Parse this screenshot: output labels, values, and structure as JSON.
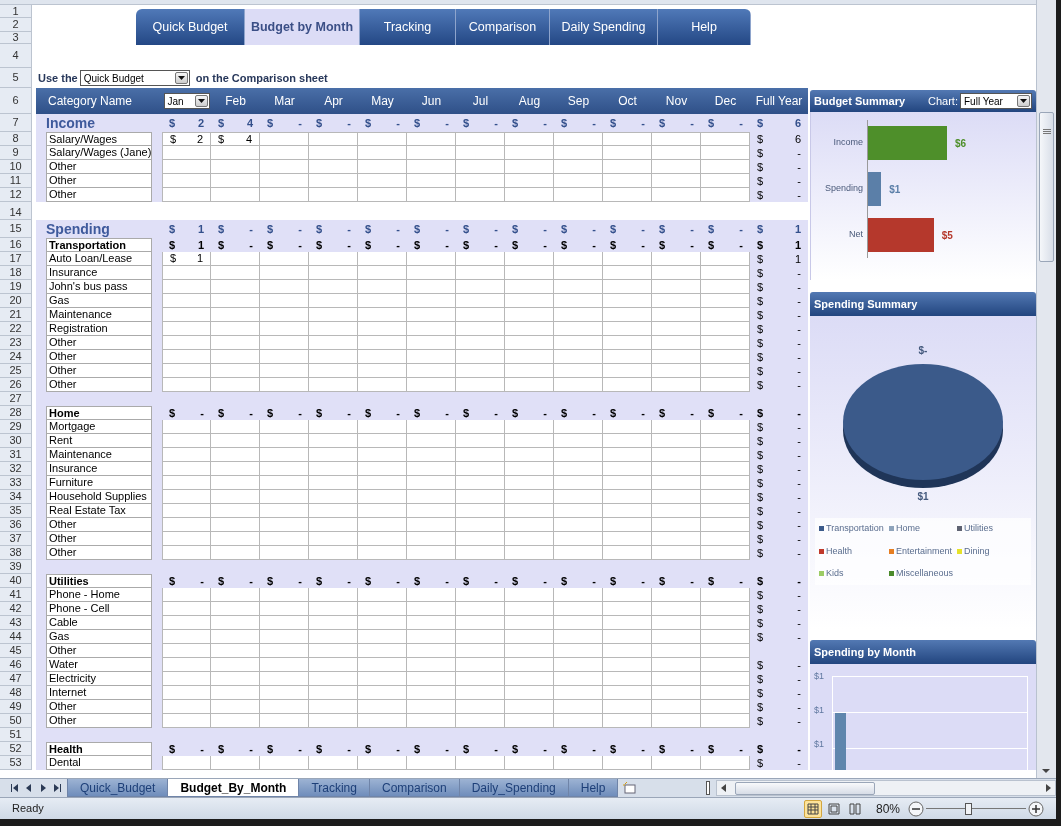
{
  "nav_tabs": [
    {
      "label": "Quick Budget",
      "selected": false
    },
    {
      "label": "Budget by Month",
      "selected": true
    },
    {
      "label": "Tracking",
      "selected": false
    },
    {
      "label": "Comparison",
      "selected": false
    },
    {
      "label": "Daily Spending",
      "selected": false
    },
    {
      "label": "Help",
      "selected": false
    }
  ],
  "top_rows": [
    "1",
    "2",
    "3",
    "4"
  ],
  "selector_row": {
    "num": "5",
    "prefix": "Use the",
    "value": "Quick Budget",
    "suffix": "on the Comparison sheet"
  },
  "header_row": {
    "num": "6",
    "category": "Category Name",
    "month_picker": "Jan",
    "months": [
      "Feb",
      "Mar",
      "Apr",
      "May",
      "Jun",
      "Jul",
      "Aug",
      "Sep",
      "Oct",
      "Nov",
      "Dec"
    ],
    "total": "Full Year"
  },
  "rows": [
    {
      "num": "7",
      "kind": "section",
      "label": "Income",
      "months": [
        [
          "$",
          "2"
        ],
        [
          "$",
          "4"
        ],
        [
          "$",
          "-"
        ],
        [
          "$",
          "-"
        ],
        [
          "$",
          "-"
        ],
        [
          "$",
          "-"
        ],
        [
          "$",
          "-"
        ],
        [
          "$",
          "-"
        ],
        [
          "$",
          "-"
        ],
        [
          "$",
          "-"
        ],
        [
          "$",
          "-"
        ],
        [
          "$",
          "-"
        ]
      ],
      "total": [
        "$",
        "6"
      ]
    },
    {
      "num": "8",
      "kind": "item",
      "label": "Salary/Wages",
      "entries": [
        [
          "$",
          "2"
        ],
        [
          "$",
          "4"
        ]
      ],
      "total": [
        "$",
        "6"
      ]
    },
    {
      "num": "9",
      "kind": "item",
      "label": "Salary/Wages (Jane)",
      "total": [
        "$",
        "-"
      ]
    },
    {
      "num": "10",
      "kind": "item",
      "label": "Other",
      "total": [
        "$",
        "-"
      ]
    },
    {
      "num": "11",
      "kind": "item",
      "label": "Other",
      "total": [
        "$",
        "-"
      ]
    },
    {
      "num": "12",
      "kind": "item",
      "label": "Other",
      "total": [
        "$",
        "-"
      ]
    },
    {
      "kind": "sliver"
    },
    {
      "num": "14",
      "kind": "blank"
    },
    {
      "num": "15",
      "kind": "section",
      "label": "Spending",
      "months": [
        [
          "$",
          "1"
        ],
        [
          "$",
          "-"
        ],
        [
          "$",
          "-"
        ],
        [
          "$",
          "-"
        ],
        [
          "$",
          "-"
        ],
        [
          "$",
          "-"
        ],
        [
          "$",
          "-"
        ],
        [
          "$",
          "-"
        ],
        [
          "$",
          "-"
        ],
        [
          "$",
          "-"
        ],
        [
          "$",
          "-"
        ],
        [
          "$",
          "-"
        ]
      ],
      "total": [
        "$",
        "1"
      ]
    },
    {
      "num": "16",
      "kind": "group",
      "label": "Transportation",
      "months": [
        [
          "$",
          "1"
        ],
        [
          "$",
          "-"
        ],
        [
          "$",
          "-"
        ],
        [
          "$",
          "-"
        ],
        [
          "$",
          "-"
        ],
        [
          "$",
          "-"
        ],
        [
          "$",
          "-"
        ],
        [
          "$",
          "-"
        ],
        [
          "$",
          "-"
        ],
        [
          "$",
          "-"
        ],
        [
          "$",
          "-"
        ],
        [
          "$",
          "-"
        ]
      ],
      "total": [
        "$",
        "1"
      ]
    },
    {
      "num": "17",
      "kind": "item",
      "label": "Auto Loan/Lease",
      "entries": [
        [
          "$",
          "1"
        ]
      ],
      "total": [
        "$",
        "1"
      ]
    },
    {
      "num": "18",
      "kind": "item",
      "label": "Insurance",
      "total": [
        "$",
        "-"
      ]
    },
    {
      "num": "19",
      "kind": "item",
      "label": "John's bus pass",
      "total": [
        "$",
        "-"
      ]
    },
    {
      "num": "20",
      "kind": "item",
      "label": "Gas",
      "total": [
        "$",
        "-"
      ]
    },
    {
      "num": "21",
      "kind": "item",
      "label": "Maintenance",
      "total": [
        "$",
        "-"
      ]
    },
    {
      "num": "22",
      "kind": "item",
      "label": "Registration",
      "total": [
        "$",
        "-"
      ]
    },
    {
      "num": "23",
      "kind": "item",
      "label": "Other",
      "total": [
        "$",
        "-"
      ]
    },
    {
      "num": "24",
      "kind": "item",
      "label": "Other",
      "total": [
        "$",
        "-"
      ]
    },
    {
      "num": "25",
      "kind": "item",
      "label": "Other",
      "total": [
        "$",
        "-"
      ]
    },
    {
      "num": "26",
      "kind": "item",
      "label": "Other",
      "total": [
        "$",
        "-"
      ]
    },
    {
      "num": "27",
      "kind": "gap"
    },
    {
      "num": "28",
      "kind": "group",
      "label": "Home",
      "months": [
        [
          "$",
          "-"
        ],
        [
          "$",
          "-"
        ],
        [
          "$",
          "-"
        ],
        [
          "$",
          "-"
        ],
        [
          "$",
          "-"
        ],
        [
          "$",
          "-"
        ],
        [
          "$",
          "-"
        ],
        [
          "$",
          "-"
        ],
        [
          "$",
          "-"
        ],
        [
          "$",
          "-"
        ],
        [
          "$",
          "-"
        ],
        [
          "$",
          "-"
        ]
      ],
      "total": [
        "$",
        "-"
      ]
    },
    {
      "num": "29",
      "kind": "item",
      "label": "Mortgage",
      "total": [
        "$",
        "-"
      ]
    },
    {
      "num": "30",
      "kind": "item",
      "label": "Rent",
      "total": [
        "$",
        "-"
      ]
    },
    {
      "num": "31",
      "kind": "item",
      "label": "Maintenance",
      "total": [
        "$",
        "-"
      ]
    },
    {
      "num": "32",
      "kind": "item",
      "label": "Insurance",
      "total": [
        "$",
        "-"
      ]
    },
    {
      "num": "33",
      "kind": "item",
      "label": "Furniture",
      "total": [
        "$",
        "-"
      ]
    },
    {
      "num": "34",
      "kind": "item",
      "label": "Household Supplies",
      "total": [
        "$",
        "-"
      ]
    },
    {
      "num": "35",
      "kind": "item",
      "label": "Real Estate Tax",
      "total": [
        "$",
        "-"
      ]
    },
    {
      "num": "36",
      "kind": "item",
      "label": "Other",
      "total": [
        "$",
        "-"
      ]
    },
    {
      "num": "37",
      "kind": "item",
      "label": "Other",
      "total": [
        "$",
        "-"
      ]
    },
    {
      "num": "38",
      "kind": "item",
      "label": "Other",
      "total": [
        "$",
        "-"
      ]
    },
    {
      "num": "39",
      "kind": "gap"
    },
    {
      "num": "40",
      "kind": "group",
      "label": "Utilities",
      "months": [
        [
          "$",
          "-"
        ],
        [
          "$",
          "-"
        ],
        [
          "$",
          "-"
        ],
        [
          "$",
          "-"
        ],
        [
          "$",
          "-"
        ],
        [
          "$",
          "-"
        ],
        [
          "$",
          "-"
        ],
        [
          "$",
          "-"
        ],
        [
          "$",
          "-"
        ],
        [
          "$",
          "-"
        ],
        [
          "$",
          "-"
        ],
        [
          "$",
          "-"
        ]
      ],
      "total": [
        "$",
        "-"
      ]
    },
    {
      "num": "41",
      "kind": "item",
      "label": "Phone - Home",
      "total": [
        "$",
        "-"
      ]
    },
    {
      "num": "42",
      "kind": "item",
      "label": "Phone - Cell",
      "total": [
        "$",
        "-"
      ]
    },
    {
      "num": "43",
      "kind": "item",
      "label": "Cable",
      "total": [
        "$",
        "-"
      ]
    },
    {
      "num": "44",
      "kind": "item",
      "label": "Gas",
      "total": [
        "$",
        "-"
      ]
    },
    {
      "num": "45",
      "kind": "item",
      "label": "Other"
    },
    {
      "num": "46",
      "kind": "item",
      "label": "Water",
      "total": [
        "$",
        "-"
      ]
    },
    {
      "num": "47",
      "kind": "item",
      "label": "Electricity",
      "total": [
        "$",
        "-"
      ]
    },
    {
      "num": "48",
      "kind": "item",
      "label": "Internet",
      "total": [
        "$",
        "-"
      ]
    },
    {
      "num": "49",
      "kind": "item",
      "label": "Other",
      "total": [
        "$",
        "-"
      ]
    },
    {
      "num": "50",
      "kind": "item",
      "label": "Other",
      "total": [
        "$",
        "-"
      ]
    },
    {
      "num": "51",
      "kind": "gap"
    },
    {
      "num": "52",
      "kind": "group",
      "label": "Health",
      "months": [
        [
          "$",
          "-"
        ],
        [
          "$",
          "-"
        ],
        [
          "$",
          "-"
        ],
        [
          "$",
          "-"
        ],
        [
          "$",
          "-"
        ],
        [
          "$",
          "-"
        ],
        [
          "$",
          "-"
        ],
        [
          "$",
          "-"
        ],
        [
          "$",
          "-"
        ],
        [
          "$",
          "-"
        ],
        [
          "$",
          "-"
        ],
        [
          "$",
          "-"
        ]
      ],
      "total": [
        "$",
        "-"
      ]
    },
    {
      "num": "53",
      "kind": "item",
      "label": "Dental",
      "total": [
        "$",
        "-"
      ]
    }
  ],
  "budget_summary": {
    "title": "Budget Summary",
    "chart_label": "Chart:",
    "chart_choice": "Full Year",
    "bars": [
      {
        "label": "Income",
        "value_label": "$6",
        "color": "#4e8f2a",
        "level": 1
      },
      {
        "label": "Spending",
        "value_label": "$1",
        "color": "#5b7fa8",
        "level": 0.167
      },
      {
        "label": "Net",
        "value_label": "$5",
        "color": "#b5382c",
        "level": 0.833
      }
    ]
  },
  "spending_summary": {
    "title": "Spending Summary",
    "top_label": "$-",
    "bottom_label": "$1",
    "legend": [
      {
        "label": "Transportation",
        "color": "#3b5a8a"
      },
      {
        "label": "Home",
        "color": "#8ea3bb"
      },
      {
        "label": "Utilities",
        "color": "#5e6272"
      },
      {
        "label": "Health",
        "color": "#c0392b"
      },
      {
        "label": "Entertainment",
        "color": "#e67e22"
      },
      {
        "label": "Dining",
        "color": "#e6e22a"
      },
      {
        "label": "Kids",
        "color": "#9ccc65"
      },
      {
        "label": "Miscellaneous",
        "color": "#4a8a2a"
      }
    ]
  },
  "spending_by_month": {
    "title": "Spending by Month",
    "y_labels": [
      "$1",
      "$1",
      "$1"
    ]
  },
  "sheet_tabs": [
    {
      "label": "Quick_Budget",
      "selected": false
    },
    {
      "label": "Budget_By_Month",
      "selected": true
    },
    {
      "label": "Tracking",
      "selected": false
    },
    {
      "label": "Comparison",
      "selected": false
    },
    {
      "label": "Daily_Spending",
      "selected": false
    },
    {
      "label": "Help",
      "selected": false
    }
  ],
  "status_bar": {
    "status": "Ready",
    "views": [
      {
        "kind": "normal",
        "selected": true
      },
      {
        "kind": "layout",
        "selected": false
      },
      {
        "kind": "pagebreak",
        "selected": false
      }
    ],
    "zoom": {
      "label": "80%",
      "level": 0.42
    }
  }
}
